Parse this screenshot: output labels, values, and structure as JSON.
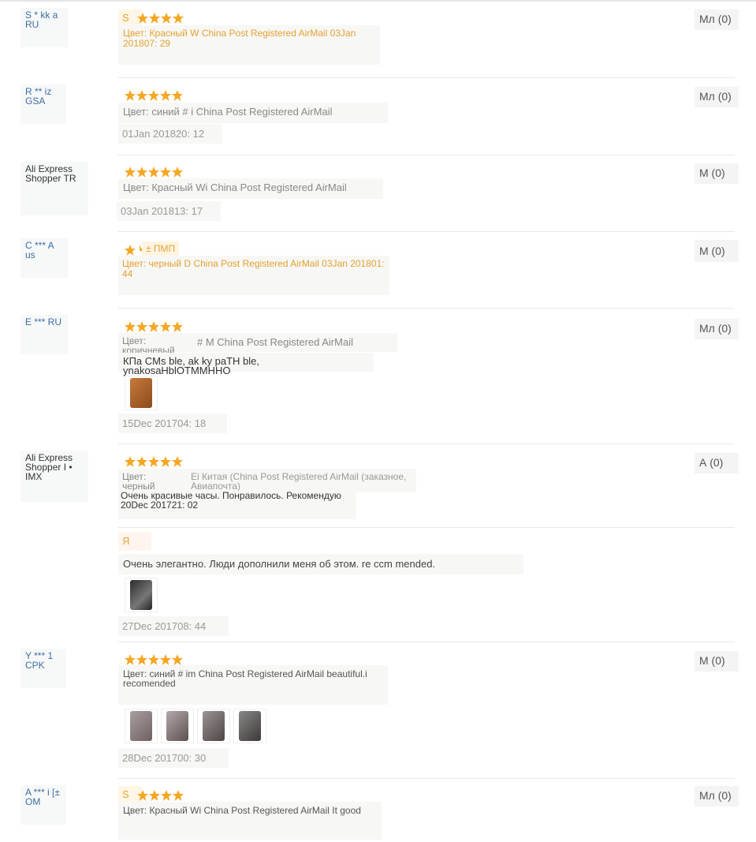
{
  "colors": {
    "star": "#f5a623",
    "user_link": "#3b6ea5",
    "orange_text": "#e5a230"
  },
  "reviews": [
    {
      "user": [
        "S * kk a",
        "RU"
      ],
      "badge": "S",
      "meta": "Цвет: Красный W China Post Registered AirMail 03Jan 201807: 29",
      "likes": "Мл (0)"
    },
    {
      "user": [
        "R ** iz",
        "GSA"
      ],
      "meta": "Цвет: синий # i China Post Registered AirMail",
      "date": "01Jan 201820: 12",
      "likes": "Мл (0)"
    },
    {
      "user": [
        "Ali Express",
        "Shopper TR"
      ],
      "meta": "Цвет: Красный Wi China Post Registered AirMail",
      "date": "03Jan 201813: 17",
      "likes": "М (0)"
    },
    {
      "user": [
        "C *** A",
        "us"
      ],
      "pmp": "± ПМП",
      "meta": "Цвет: черный D China Post Registered AirMail 03Jan 201801: 44",
      "likes": "М (0)"
    },
    {
      "user": [
        "E *** RU"
      ],
      "meta_left": "Цвет: коричневый",
      "meta_right": "# M China Post Registered AirMail",
      "comment": "КПа CMs ble, ak ky paTH ble, ynakosaHblOTMMHHO",
      "date": "15Dec 201704: 18",
      "likes": "Мл (0)"
    },
    {
      "user": [
        "Ali Express",
        "Shopper I •",
        "IMX"
      ],
      "meta_left": "Цвет: черный",
      "meta_right": "Ei Китая (China Post Registered AirMail (заказное, Авиапочта)",
      "comment": "Очень красивые часы. Понравилось. Рекомендую",
      "date_inline": "20Dec 201721: 02",
      "followup_label": "Я",
      "followup_comment": "Очень элегантно. Люди дополнили меня об этом. re ccm mended.",
      "followup_date": "27Dec 201708: 44",
      "likes": "А (0)"
    },
    {
      "user": [
        "Y *** 1",
        "CPK"
      ],
      "meta": "Цвет: синий # im China Post Registered AirMail beautiful.i recomended",
      "date": "28Dec 201700: 30",
      "likes": "М (0)"
    },
    {
      "user": [
        "A *** i [±",
        "OM"
      ],
      "badge": "S",
      "meta": "Цвет: Красный Wi China Post Registered AirMail It good",
      "likes": "Мл (0)"
    }
  ]
}
